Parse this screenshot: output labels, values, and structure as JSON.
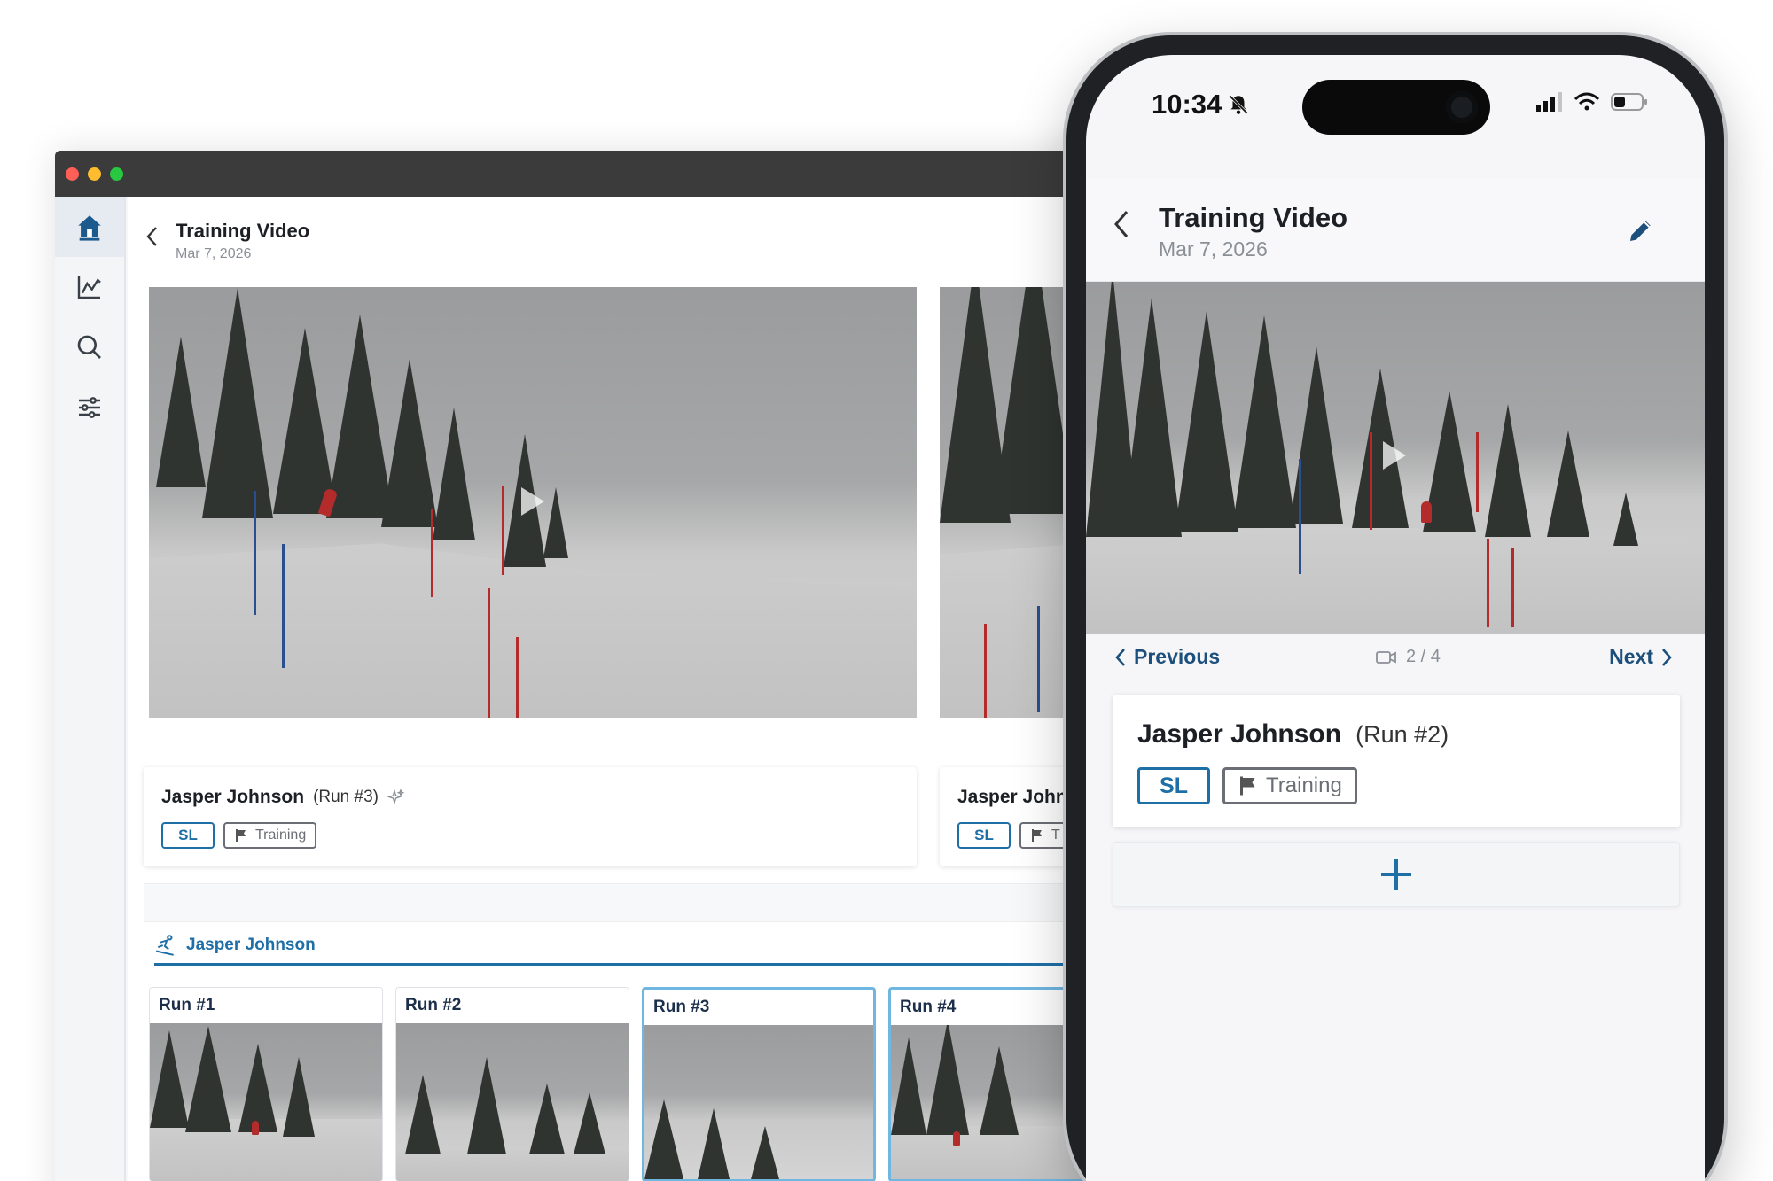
{
  "desktop": {
    "sidebar": {
      "items": [
        {
          "icon": "home-icon",
          "active": true
        },
        {
          "icon": "chart-icon",
          "active": false
        },
        {
          "icon": "search-icon",
          "active": false
        },
        {
          "icon": "sliders-icon",
          "active": false
        }
      ]
    },
    "header": {
      "title": "Training Video",
      "date": "Mar 7, 2026"
    },
    "cards": [
      {
        "athlete": "Jasper Johnson",
        "run": "(Run #3)",
        "discipline": "SL",
        "type": "Training"
      },
      {
        "athlete": "Jasper John",
        "run": "",
        "discipline": "SL",
        "type": "T"
      }
    ],
    "athlete_tab": "Jasper Johnson",
    "runs": [
      {
        "label": "Run #1",
        "selected": false
      },
      {
        "label": "Run #2",
        "selected": false
      },
      {
        "label": "Run #3",
        "selected": true
      },
      {
        "label": "Run #4",
        "selected": true
      }
    ]
  },
  "phone": {
    "status": {
      "time": "10:34"
    },
    "header": {
      "title": "Training Video",
      "date": "Mar 7, 2026"
    },
    "nav": {
      "previous": "Previous",
      "next": "Next",
      "counter": "2 / 4"
    },
    "card": {
      "athlete": "Jasper Johnson",
      "run": "(Run #2)",
      "discipline": "SL",
      "type": "Training"
    }
  },
  "colors": {
    "accent": "#1f6fa7",
    "nav_text": "#1c4f7c",
    "gate_red": "#b42b2b",
    "gate_blue": "#2a4f8f"
  }
}
